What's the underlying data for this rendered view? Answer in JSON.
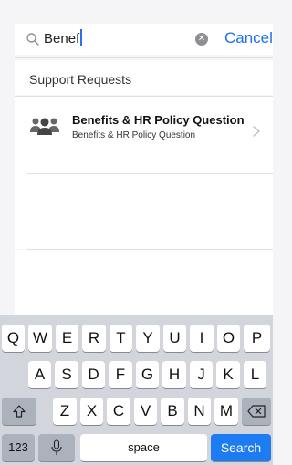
{
  "search": {
    "value": "Benef",
    "cancel_label": "Cancel"
  },
  "section": {
    "title": "Support Requests"
  },
  "results": [
    {
      "title": "Benefits & HR Policy Question",
      "subtitle": "Benefits & HR Policy Question"
    }
  ],
  "keyboard": {
    "row1": [
      "Q",
      "W",
      "E",
      "R",
      "T",
      "Y",
      "U",
      "I",
      "O",
      "P"
    ],
    "row2": [
      "A",
      "S",
      "D",
      "F",
      "G",
      "H",
      "J",
      "K",
      "L"
    ],
    "row3": [
      "Z",
      "X",
      "C",
      "V",
      "B",
      "N",
      "M"
    ],
    "numbers_label": "123",
    "space_label": "space",
    "search_label": "Search"
  },
  "colors": {
    "accent": "#1e6fe8",
    "search_key": "#1e7cf2"
  }
}
